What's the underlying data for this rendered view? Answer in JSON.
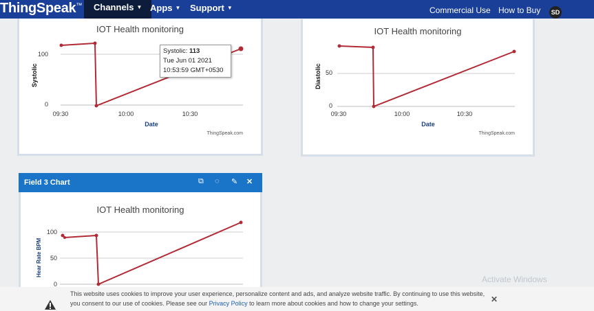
{
  "nav": {
    "brand": "ThingSpeak",
    "brand_mark": "™",
    "items": [
      "Channels",
      "Apps",
      "Support"
    ],
    "right": [
      "Commercial Use",
      "How to Buy"
    ],
    "avatar": "SD"
  },
  "charts": [
    {
      "title": "IOT Health monitoring",
      "ylabel": "Systolic",
      "xlabel": "Date",
      "yticks": [
        "100",
        "0"
      ],
      "xticks": [
        "09:30",
        "10:00",
        "10:30"
      ],
      "credit": "ThingSpeak.com"
    },
    {
      "title": "IOT Health monitoring",
      "ylabel": "Diastolic",
      "xlabel": "Date",
      "yticks": [
        "50",
        "0"
      ],
      "xticks": [
        "09:30",
        "10:00",
        "10:30"
      ],
      "credit": "ThingSpeak.com"
    },
    {
      "header": "Field 3 Chart",
      "title": "IOT Health monitoring",
      "ylabel": "Hear Rate BPM",
      "yticks": [
        "100",
        "50",
        "0"
      ]
    }
  ],
  "tooltip": {
    "label": "Systolic:",
    "value": "113",
    "date": "Tue Jun 01 2021",
    "time": "10:53:59 GMT+0530"
  },
  "cookie": {
    "text1": "This website uses cookies to improve your user experience, personalize content and ads, and analyze website traffic. By continuing to use this website,",
    "text2": "you consent to our use of cookies. Please see our",
    "link": "Privacy Policy",
    "text3": "to learn more about cookies and how to change your settings."
  },
  "watermark": "Activate Windows",
  "colors": {
    "nav": "#1a3f99",
    "series": "#b22a35",
    "panel_header": "#1a75c8"
  }
}
